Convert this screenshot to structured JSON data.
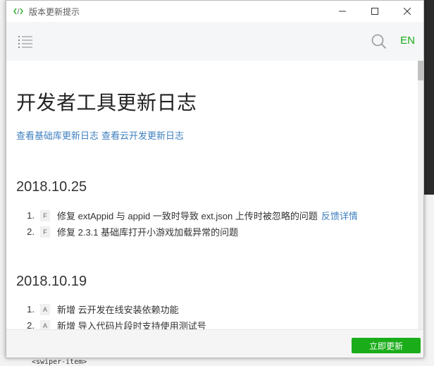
{
  "window": {
    "title": "版本更新提示"
  },
  "toolbar": {
    "lang_label": "EN"
  },
  "doc": {
    "title": "开发者工具更新日志",
    "links": [
      "查看基础库更新日志",
      "查看云开发更新日志"
    ]
  },
  "versions": [
    {
      "date": "2018.10.25",
      "entries": [
        {
          "num": "1.",
          "tag": "F",
          "text": "修复 extAppid 与 appid 一致时导致 ext.json 上传时被忽略的问题",
          "link": "反馈详情"
        },
        {
          "num": "2.",
          "tag": "F",
          "text": "修复 2.3.1 基础库打开小游戏加载异常的问题"
        }
      ]
    },
    {
      "date": "2018.10.19",
      "entries": [
        {
          "num": "1.",
          "tag": "A",
          "text": "新增 云开发在线安装依赖功能"
        },
        {
          "num": "2.",
          "tag": "A",
          "text": "新增 导入代码片段时支持使用测试号"
        }
      ]
    }
  ],
  "footer": {
    "update_label": "立即更新"
  },
  "background": {
    "code_text": "<swiper-item>"
  }
}
